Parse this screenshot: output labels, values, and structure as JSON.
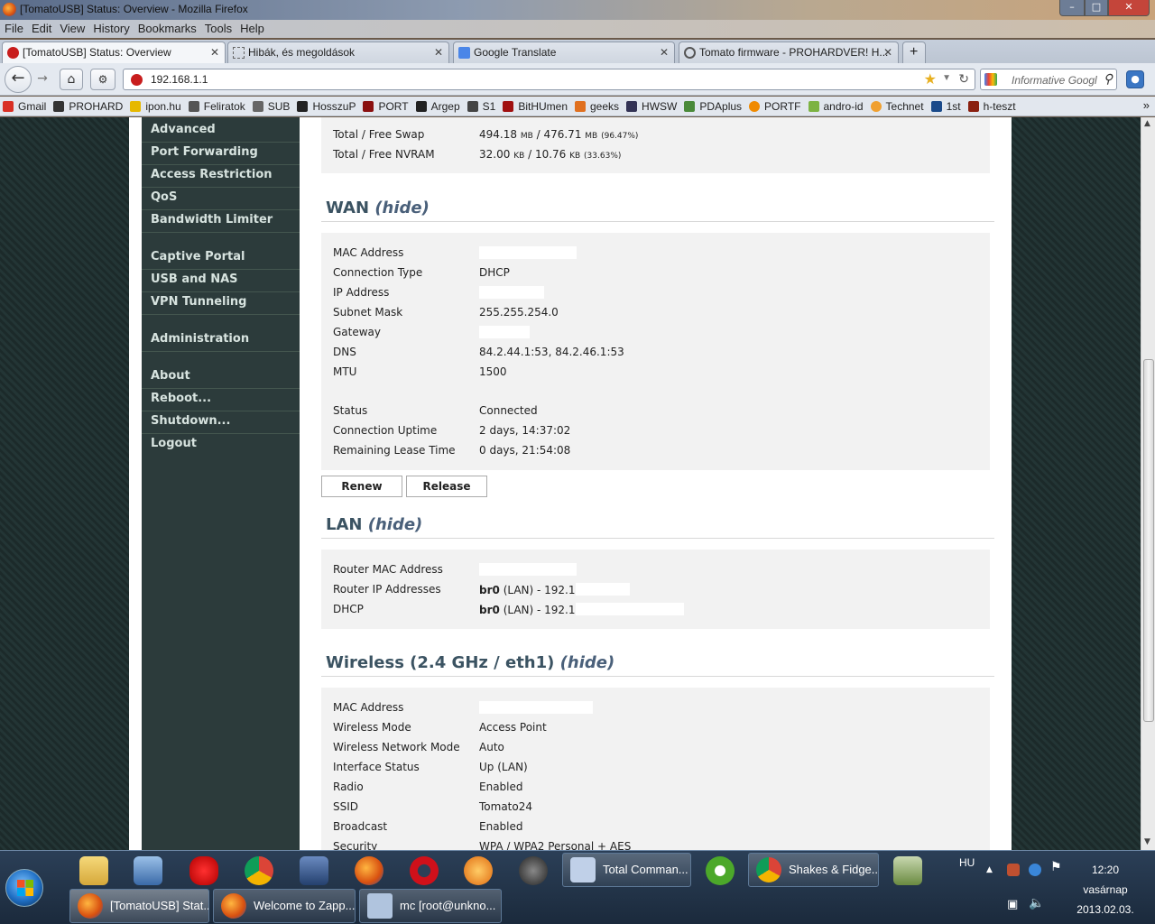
{
  "window": {
    "title": "[TomatoUSB] Status: Overview - Mozilla Firefox"
  },
  "menu": [
    "File",
    "Edit",
    "View",
    "History",
    "Bookmarks",
    "Tools",
    "Help"
  ],
  "tabs": [
    {
      "label": "[TomatoUSB] Status: Overview",
      "active": true
    },
    {
      "label": "Hibák, és megoldások"
    },
    {
      "label": "Google Translate"
    },
    {
      "label": "Tomato firmware - PROHARDVER! H..."
    }
  ],
  "navbar": {
    "url": "192.168.1.1",
    "search_placeholder": "Informative Googl"
  },
  "bookmarks": [
    "Gmail",
    "PROHARD",
    "ipon.hu",
    "Feliratok",
    "SUB",
    "HosszuP",
    "PORT",
    "Argep",
    "S1",
    "BitHUmen",
    "geeks",
    "HWSW",
    "PDAplus",
    "PORTF",
    "andro-id",
    "Technet",
    "1st",
    "h-teszt"
  ],
  "sidebar": {
    "group1": [
      "Advanced",
      "Port Forwarding",
      "Access Restriction",
      "QoS",
      "Bandwidth Limiter"
    ],
    "group2": [
      "Captive Portal",
      "USB and NAS",
      "VPN Tunneling"
    ],
    "group3": [
      "Administration"
    ],
    "group4": [
      "About",
      "Reboot...",
      "Shutdown...",
      "Logout"
    ]
  },
  "memory": {
    "swap_label": "Total / Free Swap",
    "swap_value": "494.18",
    "swap_unit1": "MB",
    "swap_value2": "/ 476.71",
    "swap_unit2": "MB",
    "swap_pct": "(96.47%)",
    "nvram_label": "Total / Free NVRAM",
    "nvram_value": "32.00",
    "nvram_unit1": "KB",
    "nvram_value2": "/ 10.76",
    "nvram_unit2": "KB",
    "nvram_pct": "(33.63%)"
  },
  "wan": {
    "title": "WAN",
    "toggle": "(hide)",
    "rows": [
      {
        "label": "MAC Address",
        "value": ""
      },
      {
        "label": "Connection Type",
        "value": "DHCP"
      },
      {
        "label": "IP Address",
        "value": ""
      },
      {
        "label": "Subnet Mask",
        "value": "255.255.254.0"
      },
      {
        "label": "Gateway",
        "value": ""
      },
      {
        "label": "DNS",
        "value": "84.2.44.1:53, 84.2.46.1:53"
      },
      {
        "label": "MTU",
        "value": "1500"
      },
      {
        "label": "Status",
        "value": "Connected"
      },
      {
        "label": "Connection Uptime",
        "value": "2 days, 14:37:02"
      },
      {
        "label": "Remaining Lease Time",
        "value": "0 days, 21:54:08"
      }
    ],
    "renew": "Renew",
    "release": "Release"
  },
  "lan": {
    "title": "LAN",
    "toggle": "(hide)",
    "rows": [
      {
        "label": "Router MAC Address",
        "value": ""
      },
      {
        "label": "Router IP Addresses",
        "iface": "br0",
        "value": "(LAN) - 192.1"
      },
      {
        "label": "DHCP",
        "iface": "br0",
        "value": "(LAN) - 192.1"
      }
    ]
  },
  "wireless": {
    "title": "Wireless (2.4 GHz / eth1)",
    "toggle": "(hide)",
    "rows": [
      {
        "label": "MAC Address",
        "value": ""
      },
      {
        "label": "Wireless Mode",
        "value": "Access Point"
      },
      {
        "label": "Wireless Network Mode",
        "value": "Auto"
      },
      {
        "label": "Interface Status",
        "value": "Up (LAN)"
      },
      {
        "label": "Radio",
        "value": "Enabled"
      },
      {
        "label": "SSID",
        "value": "Tomato24"
      },
      {
        "label": "Broadcast",
        "value": "Enabled"
      },
      {
        "label": "Security",
        "value": "WPA / WPA2 Personal + AES"
      }
    ]
  },
  "taskbar": {
    "buttons": [
      "Total Comman...",
      "Shakes & Fidge...",
      "[TomatoUSB] Stat...",
      "Welcome to Zapp...",
      "mc [root@unkno..."
    ],
    "lang": "HU",
    "time": "12:20",
    "day": "vasárnap",
    "date": "2013.02.03."
  },
  "colors": {
    "sidebar_bg": "#2c3b3b",
    "section_title": "#3b5362",
    "panel_bg": "#f2f2f2"
  }
}
